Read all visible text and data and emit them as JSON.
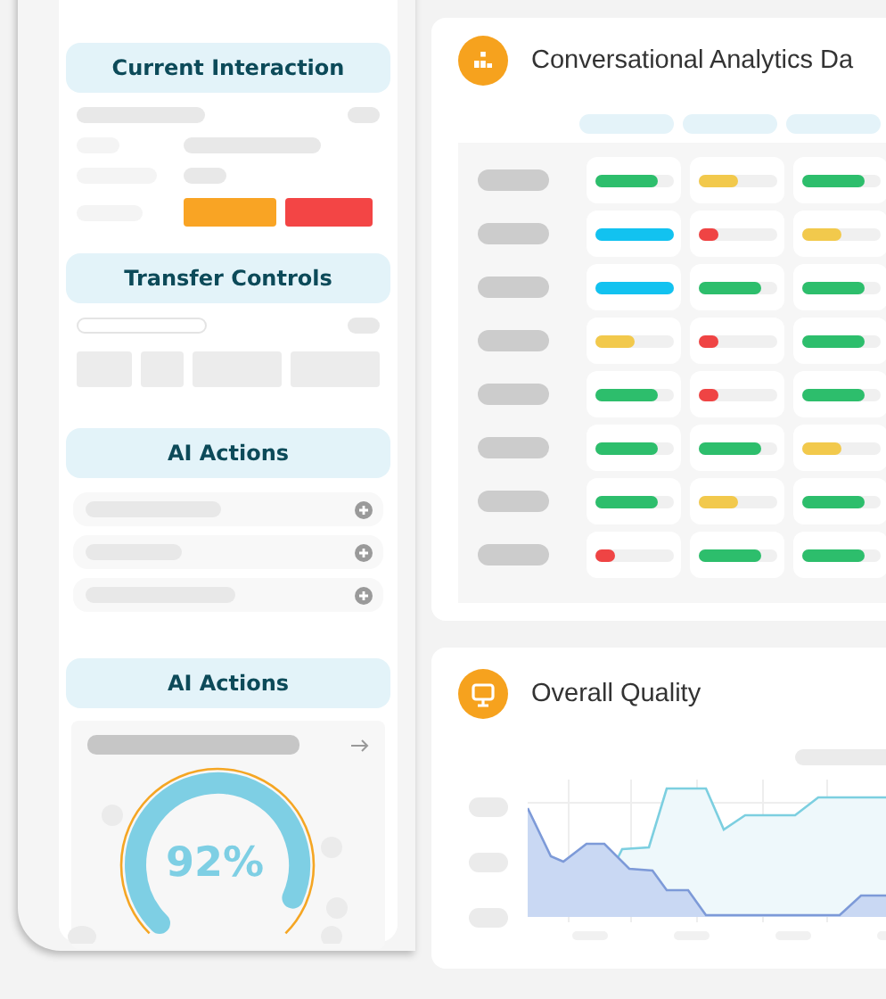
{
  "sidebar": {
    "sections": [
      {
        "kind": "interaction",
        "title": "Current Interaction"
      },
      {
        "kind": "transfer",
        "title": "Transfer Controls"
      },
      {
        "kind": "actions",
        "title": "AI Actions"
      },
      {
        "kind": "gauge",
        "title": "AI Actions",
        "value": "92%"
      }
    ]
  },
  "analytics": {
    "title": "Conversational Analytics Da",
    "rows": [
      {
        "cells": [
          {
            "level": 0.8,
            "color": "#2dbe6c"
          },
          {
            "level": 0.5,
            "color": "#f2c94c"
          },
          {
            "level": 0.8,
            "color": "#2dbe6c"
          }
        ]
      },
      {
        "cells": [
          {
            "level": 1,
            "color": "#12c2f0"
          },
          {
            "level": 0.25,
            "color": "#ef4444"
          },
          {
            "level": 0.5,
            "color": "#f2c94c"
          }
        ]
      },
      {
        "cells": [
          {
            "level": 1,
            "color": "#12c2f0"
          },
          {
            "level": 0.8,
            "color": "#2dbe6c"
          },
          {
            "level": 0.8,
            "color": "#2dbe6c"
          }
        ]
      },
      {
        "cells": [
          {
            "level": 0.5,
            "color": "#f2c94c"
          },
          {
            "level": 0.25,
            "color": "#ef4444"
          },
          {
            "level": 0.8,
            "color": "#2dbe6c"
          }
        ]
      },
      {
        "cells": [
          {
            "level": 0.8,
            "color": "#2dbe6c"
          },
          {
            "level": 0.25,
            "color": "#ef4444"
          },
          {
            "level": 0.8,
            "color": "#2dbe6c"
          }
        ]
      },
      {
        "cells": [
          {
            "level": 0.8,
            "color": "#2dbe6c"
          },
          {
            "level": 0.8,
            "color": "#2dbe6c"
          },
          {
            "level": 0.5,
            "color": "#f2c94c"
          }
        ]
      },
      {
        "cells": [
          {
            "level": 0.8,
            "color": "#2dbe6c"
          },
          {
            "level": 0.5,
            "color": "#f2c94c"
          },
          {
            "level": 0.8,
            "color": "#2dbe6c"
          }
        ]
      },
      {
        "cells": [
          {
            "level": 0.25,
            "color": "#ef4444"
          },
          {
            "level": 0.8,
            "color": "#2dbe6c"
          },
          {
            "level": 0.8,
            "color": "#2dbe6c"
          }
        ]
      }
    ]
  },
  "quality": {
    "title": "Overall Quality"
  }
}
